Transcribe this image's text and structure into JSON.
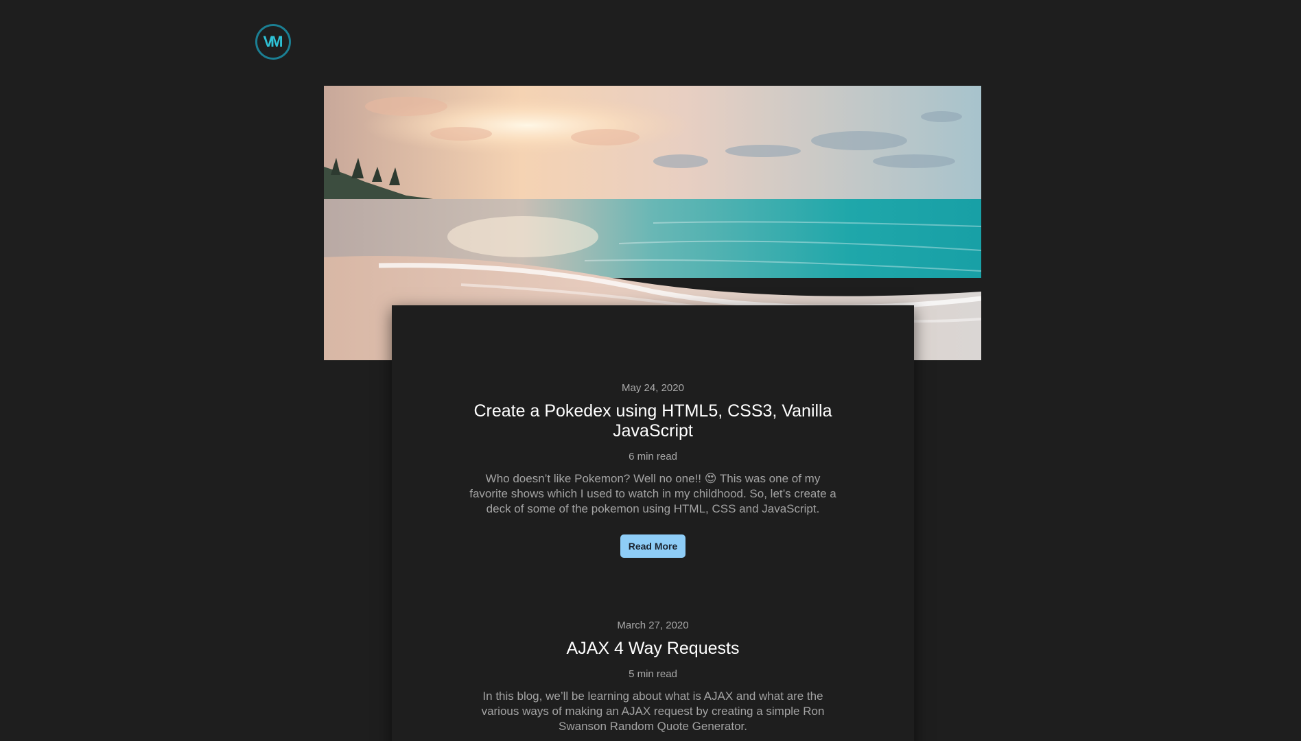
{
  "logo": {
    "text": "VM",
    "color": "#2ec2d6"
  },
  "hero": {
    "alt": "Beach at sunset"
  },
  "posts": [
    {
      "date": "May 24, 2020",
      "title": "Create a Pokedex using HTML5, CSS3, Vanilla JavaScript",
      "read_time": "6 min read",
      "excerpt": "Who doesn’t like Pokemon? Well no one!! 😍 This was one of my favorite shows which I used to watch in my childhood. So, let’s create a deck of some of the pokemon using HTML, CSS and JavaScript.",
      "button": "Read More"
    },
    {
      "date": "March 27, 2020",
      "title": "AJAX 4 Way Requests",
      "read_time": "5 min read",
      "excerpt": "In this blog, we’ll be learning about what is AJAX and what are the various ways of making an AJAX request by creating a simple Ron Swanson Random Quote Generator."
    }
  ],
  "colors": {
    "background": "#1e1e1e",
    "button": "#8ecdf7",
    "logo_ring": "#1b7f93"
  }
}
